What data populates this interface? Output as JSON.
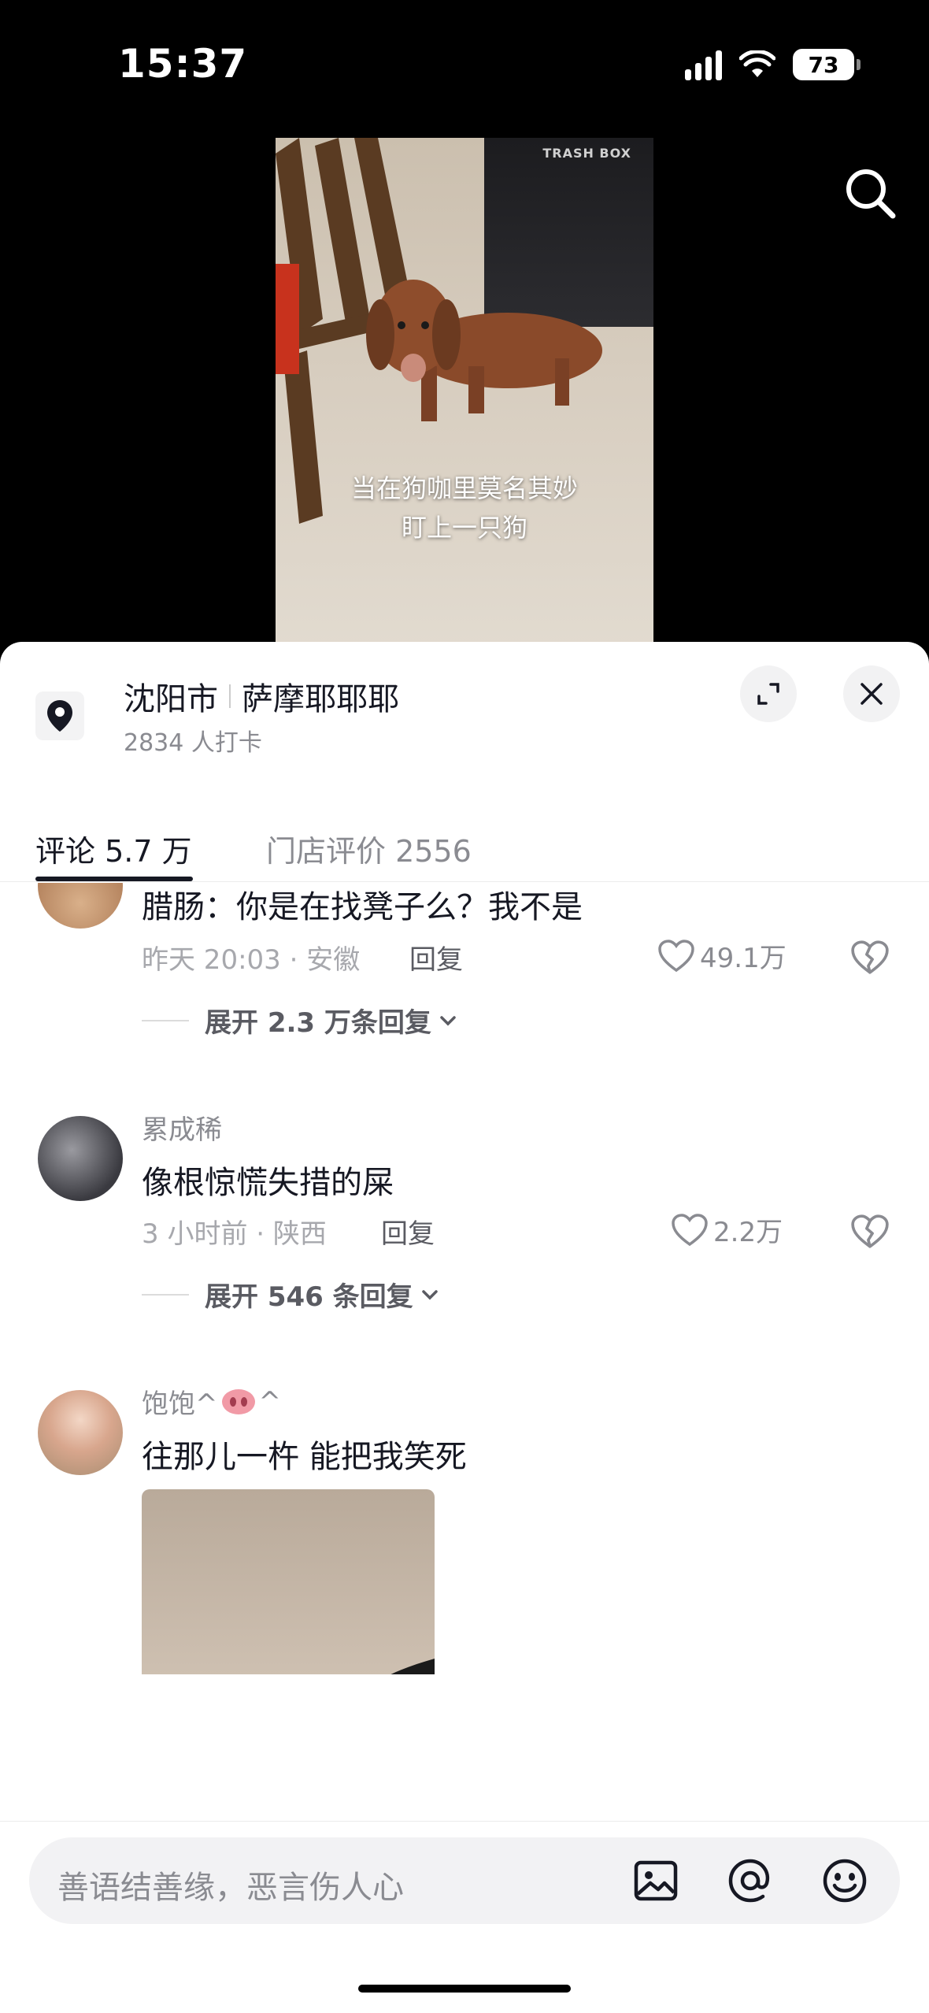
{
  "status_bar": {
    "time": "15:37",
    "battery": "73"
  },
  "video": {
    "caption_line1": "当在狗咖里莫名其妙",
    "caption_line2": "盯上一只狗",
    "bin_label": "TRASH BOX"
  },
  "location": {
    "city": "沈阳市",
    "place": "萨摩耶耶耶",
    "checkins": "2834 人打卡"
  },
  "tabs": [
    {
      "label": "评论 5.7 万"
    },
    {
      "label": "门店评价 2556"
    }
  ],
  "comments": [
    {
      "text": "腊肠：你是在找凳子么？我不是",
      "meta": "昨天 20:03 · 安徽",
      "reply": "回复",
      "likes": "49.1万",
      "expand": "展开 2.3 万条回复"
    },
    {
      "name": "累成稀",
      "text": "像根惊慌失措的屎",
      "meta": "3 小时前 · 陕西",
      "reply": "回复",
      "likes": "2.2万",
      "expand": "展开 546 条回复"
    },
    {
      "name": "饱饱^",
      "name_suffix": "^",
      "text": "往那儿一杵 能把我笑死"
    }
  ],
  "input": {
    "placeholder": "善语结善缘，恶言伤人心"
  },
  "icons": {
    "search": "search-icon",
    "location": "location-pin-icon",
    "expand": "expand-icon",
    "close": "close-icon",
    "like": "heart-icon",
    "dislike": "broken-heart-icon",
    "image": "image-icon",
    "mention": "at-icon",
    "emoji": "emoji-icon"
  }
}
